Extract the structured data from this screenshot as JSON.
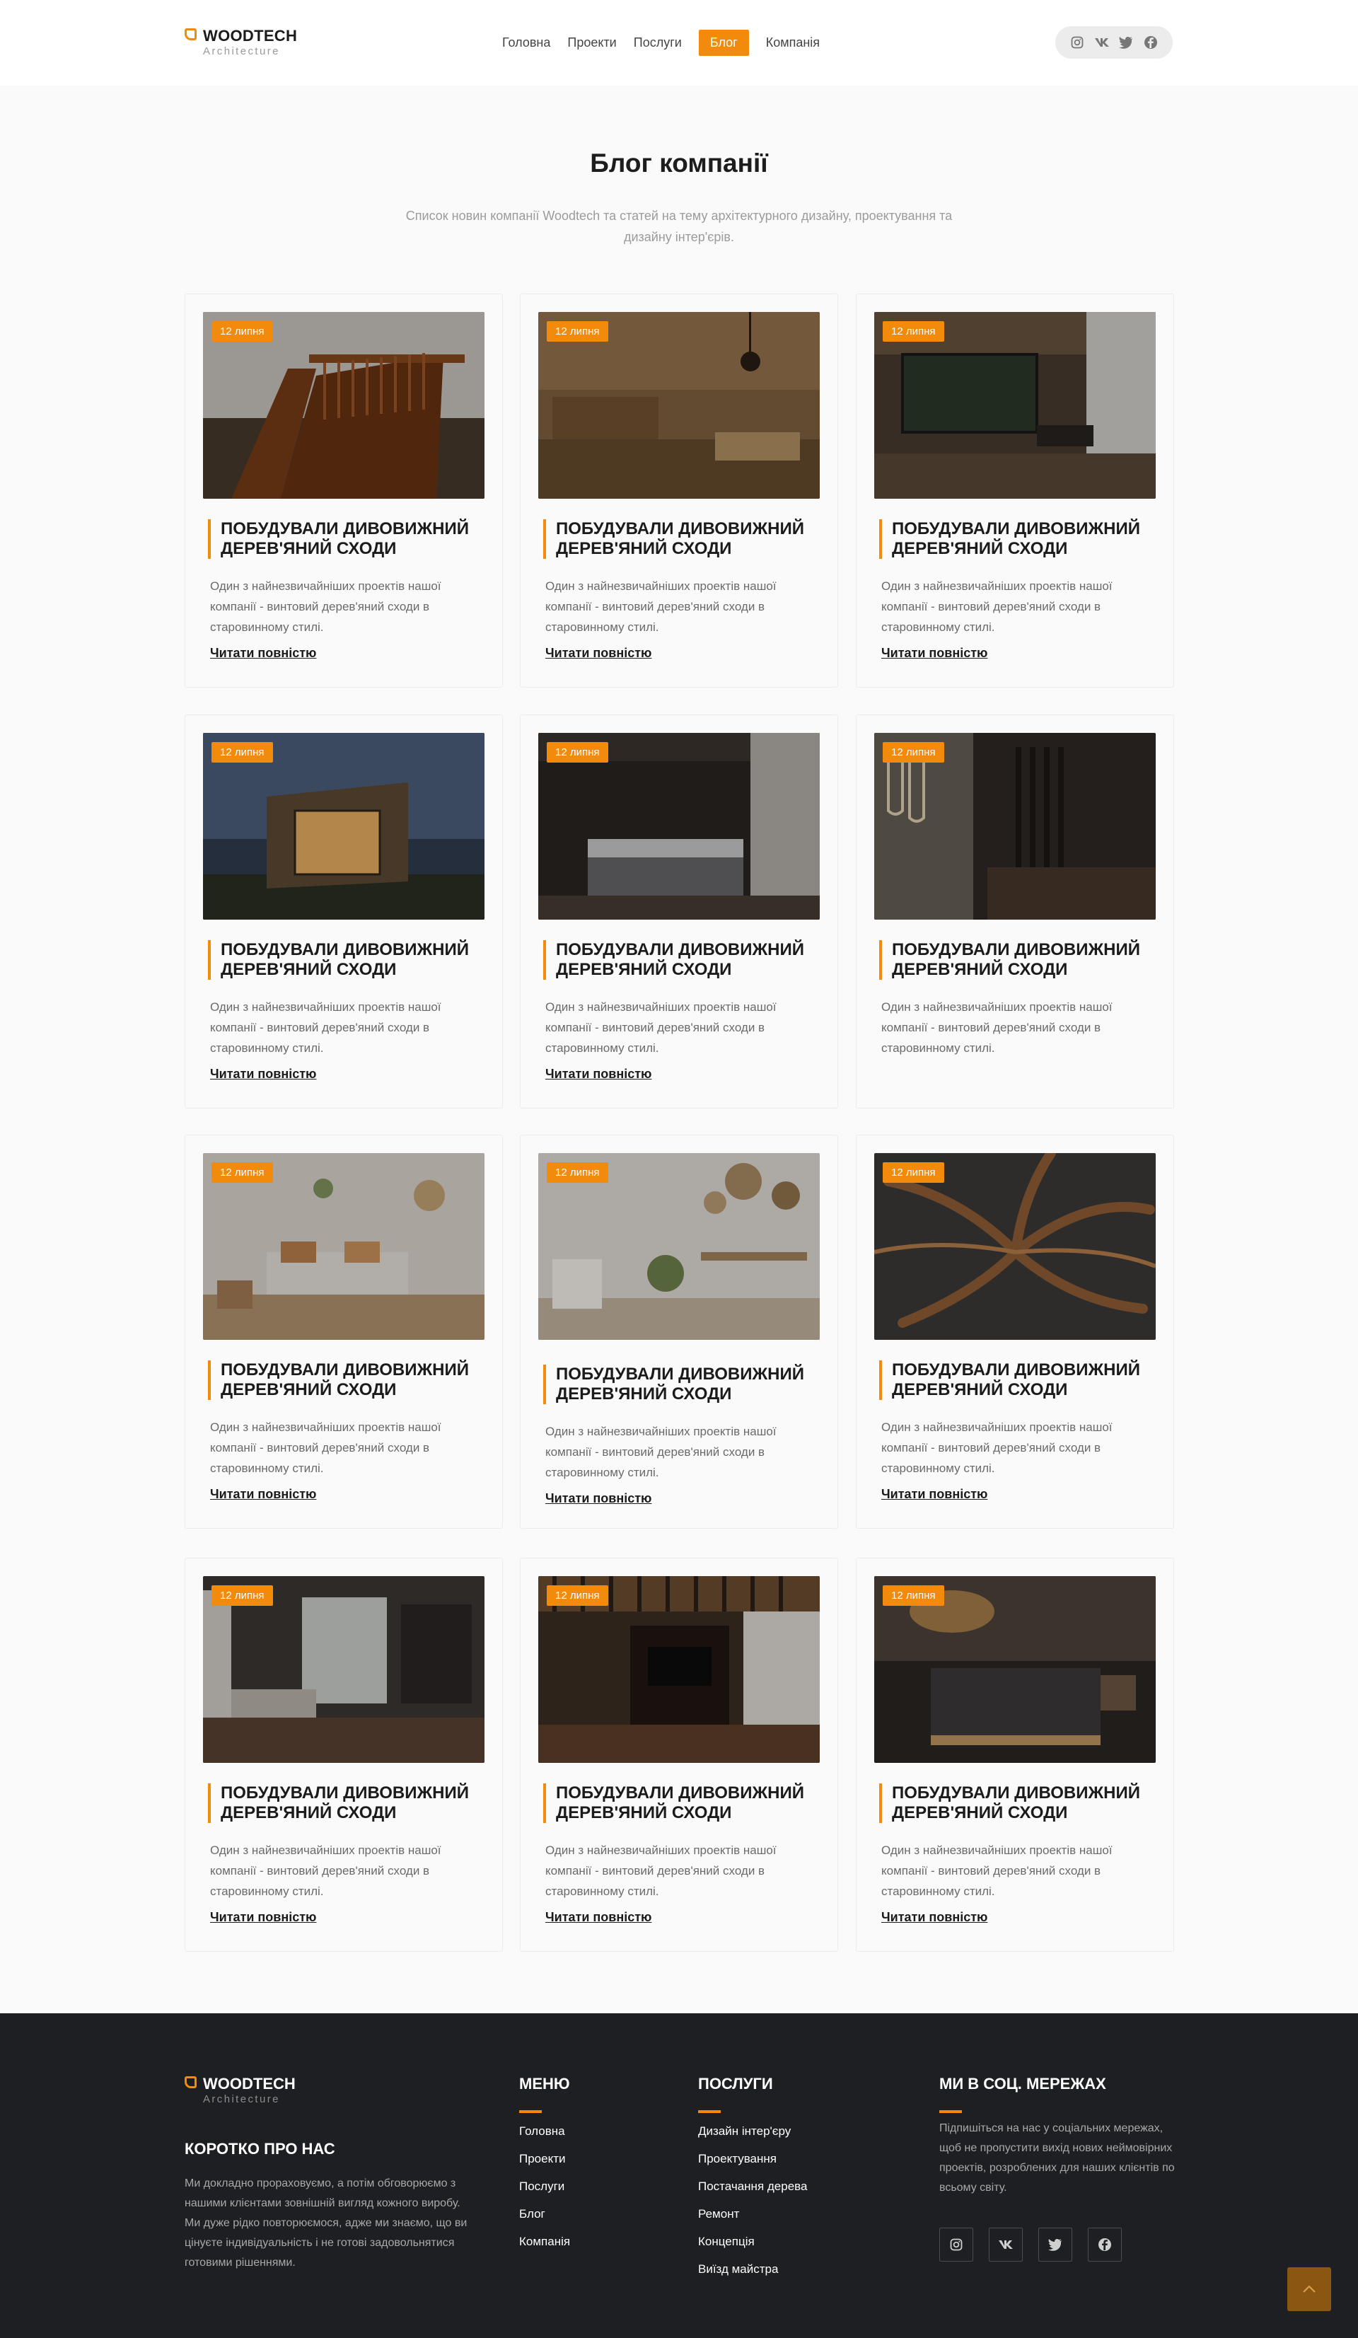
{
  "header": {
    "logo": {
      "brand": "WOODTECH",
      "sub": "Architecture"
    },
    "nav": [
      {
        "label": "Головна",
        "active": false
      },
      {
        "label": "Проекти",
        "active": false
      },
      {
        "label": "Послуги",
        "active": false
      },
      {
        "label": "Блог",
        "active": true
      },
      {
        "label": "Компанія",
        "active": false
      }
    ],
    "socials": [
      "instagram-icon",
      "vk-icon",
      "twitter-icon",
      "facebook-icon"
    ]
  },
  "intro": {
    "title": "Блог компанії",
    "description": "Список новин компанії Woodtech та статей на тему архітектурного дизайну, проектування та дизайну інтер'єрів."
  },
  "posts": [
    {
      "date": "12 липня",
      "title": "ПОБУДУВАЛИ ДИВОВИЖНИЙ ДЕРЕВ'ЯНИЙ СХОДИ",
      "text": "Один з найнезвичайніших проектів нашої компанії - винтовий дерев'яний сходи в старовинному стилі.",
      "link": "Читати повністю"
    },
    {
      "date": "12 липня",
      "title": "ПОБУДУВАЛИ ДИВОВИЖНИЙ ДЕРЕВ'ЯНИЙ СХОДИ",
      "text": "Один з найнезвичайніших проектів нашої компанії - винтовий дерев'яний сходи в старовинному стилі.",
      "link": "Читати повністю"
    },
    {
      "date": "12 липня",
      "title": "ПОБУДУВАЛИ ДИВОВИЖНИЙ ДЕРЕВ'ЯНИЙ СХОДИ",
      "text": "Один з найнезвичайніших проектів нашої компанії - винтовий дерев'яний сходи в старовинному стилі.",
      "link": "Читати повністю"
    },
    {
      "date": "12 липня",
      "title": "ПОБУДУВАЛИ ДИВОВИЖНИЙ ДЕРЕВ'ЯНИЙ СХОДИ",
      "text": "Один з найнезвичайніших проектів нашої компанії - винтовий дерев'яний сходи в старовинному стилі.",
      "link": "Читати повністю"
    },
    {
      "date": "12 липня",
      "title": "ПОБУДУВАЛИ ДИВОВИЖНИЙ ДЕРЕВ'ЯНИЙ СХОДИ",
      "text": "Один з найнезвичайніших проектів нашої компанії - винтовий дерев'яний сходи в старовинному стилі.",
      "link": "Читати повністю"
    },
    {
      "date": "12 липня",
      "title": "ПОБУДУВАЛИ ДИВОВИЖНИЙ ДЕРЕВ'ЯНИЙ СХОДИ",
      "text": "Один з найнезвичайніших проектів нашої компанії - винтовий дерев'яний сходи в старовинному стилі.",
      "link": ""
    },
    {
      "date": "12 липня",
      "title": "ПОБУДУВАЛИ ДИВОВИЖНИЙ ДЕРЕВ'ЯНИЙ СХОДИ",
      "text": "Один з найнезвичайніших проектів нашої компанії - винтовий дерев'яний сходи в старовинному стилі.",
      "link": "Читати повністю"
    },
    {
      "date": "12 липня",
      "title": "ПОБУДУВАЛИ ДИВОВИЖНИЙ ДЕРЕВ'ЯНИЙ СХОДИ",
      "text": "Один з найнезвичайніших проектів нашої компанії - винтовий дерев'яний сходи в старовинному стилі.",
      "link": "Читати повністю"
    },
    {
      "date": "12 липня",
      "title": "ПОБУДУВАЛИ ДИВОВИЖНИЙ ДЕРЕВ'ЯНИЙ СХОДИ",
      "text": "Один з найнезвичайніших проектів нашої компанії - винтовий дерев'яний сходи в старовинному стилі.",
      "link": "Читати повністю"
    },
    {
      "date": "12 липня",
      "title": "ПОБУДУВАЛИ ДИВОВИЖНИЙ ДЕРЕВ'ЯНИЙ СХОДИ",
      "text": "Один з найнезвичайніших проектів нашої компанії - винтовий дерев'яний сходи в старовинному стилі.",
      "link": "Читати повністю"
    },
    {
      "date": "12 липня",
      "title": "ПОБУДУВАЛИ ДИВОВИЖНИЙ ДЕРЕВ'ЯНИЙ СХОДИ",
      "text": "Один з найнезвичайніших проектів нашої компанії - винтовий дерев'яний сходи в старовинному стилі.",
      "link": "Читати повністю"
    },
    {
      "date": "12 липня",
      "title": "ПОБУДУВАЛИ ДИВОВИЖНИЙ ДЕРЕВ'ЯНИЙ СХОДИ",
      "text": "Один з найнезвичайніших проектів нашої компанії - винтовий дерев'яний сходи в старовинному стилі.",
      "link": "Читати повністю"
    }
  ],
  "footer": {
    "logo": {
      "brand": "WOODTECH",
      "sub": "Architecture"
    },
    "about_title": "КОРОТКО ПРО НАС",
    "about_text": "Ми докладно прораховуємо, а потім обговорюємо з нашими клієнтами зовнішній вигляд кожного виробу. Ми дуже рідко повторюємося, адже ми знаємо, що ви цінуєте індивідуальність і не готові задовольнятися готовими рішеннями.",
    "menu_title": "МЕНЮ",
    "menu": [
      "Головна",
      "Проекти",
      "Послуги",
      "Блог",
      "Компанія"
    ],
    "services_title": "ПОСЛУГИ",
    "services": [
      "Дизайн інтер'єру",
      "Проектування",
      "Постачання дерева",
      "Ремонт",
      "Концепція",
      "Виїзд майстра"
    ],
    "social_title": "МИ В СОЦ. МЕРЕЖАХ",
    "social_text": "Підпишіться на нас у соціальних мережах, щоб не пропустити вихід нових неймовірних проектів, розроблених для наших клієнтів по всьому світу.",
    "icons": [
      "instagram-icon",
      "vk-icon",
      "twitter-icon",
      "facebook-icon"
    ]
  },
  "colors": {
    "accent": "#f28a0c",
    "footer_bg": "#1d1f22",
    "page_bg": "#fafafa"
  }
}
